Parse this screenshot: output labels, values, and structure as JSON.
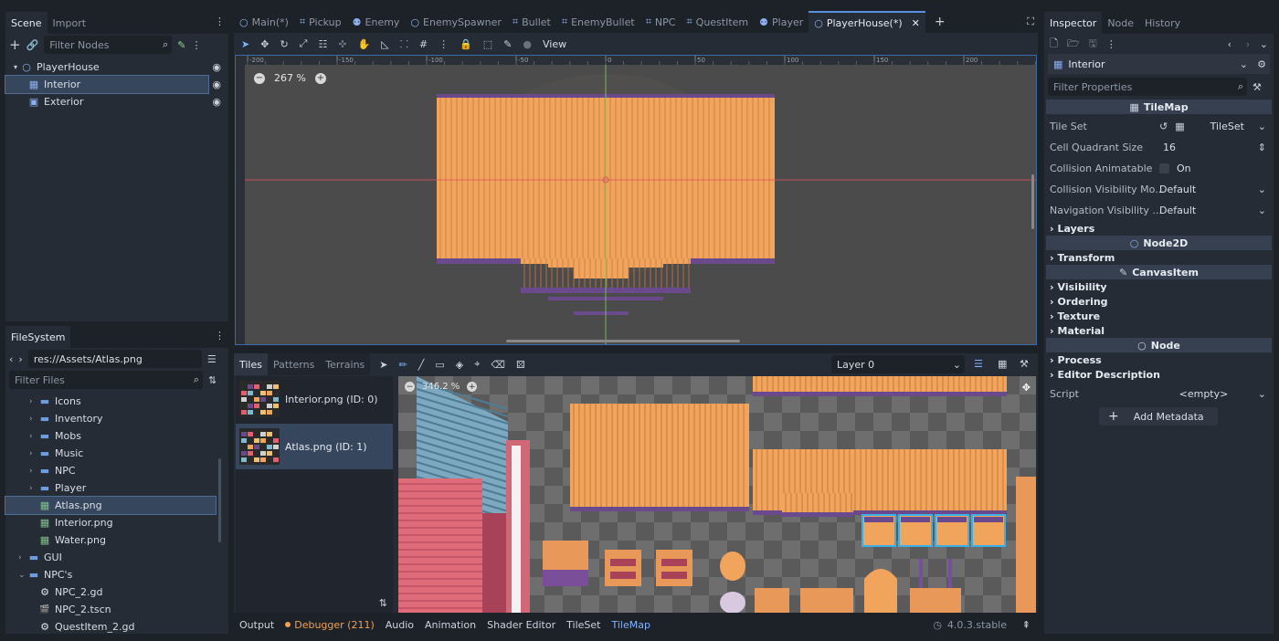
{
  "colors": {
    "accent": "#5a8fe0",
    "debugger": "#f0a050",
    "tilemap_active": "#7fb4ff",
    "wood": "#f0a45c",
    "wood_dark": "#6a4a8c"
  },
  "scene_dock": {
    "tabs": [
      "Scene",
      "Import"
    ],
    "filter_placeholder": "Filter Nodes",
    "nodes": [
      {
        "label": "PlayerHouse",
        "icon": "node2d-icon"
      },
      {
        "label": "Interior",
        "icon": "tilemap-icon"
      },
      {
        "label": "Exterior",
        "icon": "tilemap-icon"
      }
    ]
  },
  "filesystem": {
    "tab": "FileSystem",
    "path": "res://Assets/Atlas.png",
    "filter_placeholder": "Filter Files",
    "items": [
      {
        "label": "Icons",
        "type": "folder",
        "depth": 1
      },
      {
        "label": "Inventory",
        "type": "folder",
        "depth": 1
      },
      {
        "label": "Mobs",
        "type": "folder",
        "depth": 1
      },
      {
        "label": "Music",
        "type": "folder",
        "depth": 1
      },
      {
        "label": "NPC",
        "type": "folder",
        "depth": 1
      },
      {
        "label": "Player",
        "type": "folder",
        "depth": 1
      },
      {
        "label": "Atlas.png",
        "type": "image",
        "depth": 1
      },
      {
        "label": "Interior.png",
        "type": "image",
        "depth": 1
      },
      {
        "label": "Water.png",
        "type": "image",
        "depth": 1
      },
      {
        "label": "GUI",
        "type": "folder",
        "depth": 0
      },
      {
        "label": "NPC's",
        "type": "folder-open",
        "depth": 0
      },
      {
        "label": "NPC_2.gd",
        "type": "script",
        "depth": 1
      },
      {
        "label": "NPC_2.tscn",
        "type": "scene",
        "depth": 1
      },
      {
        "label": "QuestItem_2.gd",
        "type": "script",
        "depth": 1
      }
    ]
  },
  "editor_tabs": [
    {
      "label": "Main(*)",
      "icon": "node2d-icon"
    },
    {
      "label": "Pickup",
      "icon": "area-icon"
    },
    {
      "label": "Enemy",
      "icon": "body-icon"
    },
    {
      "label": "EnemySpawner",
      "icon": "node2d-icon"
    },
    {
      "label": "Bullet",
      "icon": "area-icon"
    },
    {
      "label": "EnemyBullet",
      "icon": "area-icon"
    },
    {
      "label": "NPC",
      "icon": "area-icon"
    },
    {
      "label": "QuestItem",
      "icon": "area-icon"
    },
    {
      "label": "Player",
      "icon": "body-icon"
    },
    {
      "label": "PlayerHouse(*)",
      "icon": "node2d-icon"
    }
  ],
  "viewport": {
    "toolbar_view": "View",
    "zoom": "267 %",
    "ruler_labels": [
      "-200",
      "-150",
      "-100",
      "-50",
      "0",
      "50",
      "100",
      "150",
      "200"
    ]
  },
  "tiles_panel": {
    "tabs": [
      "Tiles",
      "Patterns",
      "Terrains"
    ],
    "layer_select": "Layer 0",
    "sources": [
      "Interior.png (ID: 0)",
      "Atlas.png (ID: 1)"
    ],
    "zoom": "346.2 %"
  },
  "bottom_bar": {
    "tabs": [
      "Output",
      "Debugger (211)",
      "Audio",
      "Animation",
      "Shader Editor",
      "TileSet",
      "TileMap"
    ],
    "version": "4.0.3.stable"
  },
  "inspector": {
    "tabs": [
      "Inspector",
      "Node",
      "History"
    ],
    "object": "Interior",
    "filter_placeholder": "Filter Properties",
    "class_tilemap": "TileMap",
    "props": [
      {
        "label": "Tile Set",
        "value": "TileSet"
      },
      {
        "label": "Cell Quadrant Size",
        "value": "16"
      },
      {
        "label": "Collision Animatable",
        "value": "On"
      },
      {
        "label": "Collision Visibility Mo...",
        "value": "Default"
      },
      {
        "label": "Navigation Visibility ...",
        "value": "Default"
      }
    ],
    "sections": {
      "layers": "Layers",
      "node2d": "Node2D",
      "transform": "Transform",
      "canvasitem": "CanvasItem",
      "visibility": "Visibility",
      "ordering": "Ordering",
      "texture": "Texture",
      "material": "Material",
      "node": "Node",
      "process": "Process",
      "editor_description": "Editor Description"
    },
    "script_label": "Script",
    "script_value": "<empty>",
    "add_metadata": "Add Metadata"
  }
}
